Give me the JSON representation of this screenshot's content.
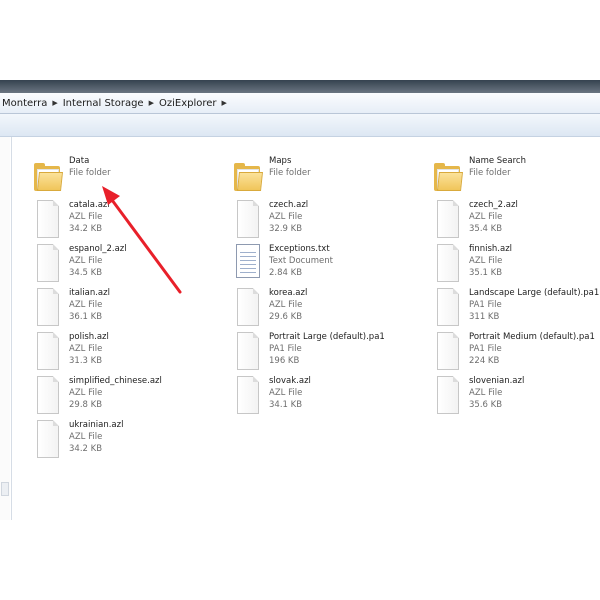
{
  "address_bar": {
    "crumbs": [
      "Monterra",
      "Internal Storage",
      "OziExplorer"
    ]
  },
  "items": [
    {
      "name": "Data",
      "type": "File folder",
      "size": "",
      "icon": "folder-icon"
    },
    {
      "name": "Maps",
      "type": "File folder",
      "size": "",
      "icon": "folder-icon"
    },
    {
      "name": "Name Search",
      "type": "File folder",
      "size": "",
      "icon": "folder-icon"
    },
    {
      "name": "catala.azl",
      "type": "AZL File",
      "size": "34.2 KB",
      "icon": "file-icon"
    },
    {
      "name": "czech.azl",
      "type": "AZL File",
      "size": "32.9 KB",
      "icon": "file-icon"
    },
    {
      "name": "czech_2.azl",
      "type": "AZL File",
      "size": "35.4 KB",
      "icon": "file-icon"
    },
    {
      "name": "espanol_2.azl",
      "type": "AZL File",
      "size": "34.5 KB",
      "icon": "file-icon"
    },
    {
      "name": "Exceptions.txt",
      "type": "Text Document",
      "size": "2.84 KB",
      "icon": "text-document-icon"
    },
    {
      "name": "finnish.azl",
      "type": "AZL File",
      "size": "35.1 KB",
      "icon": "file-icon"
    },
    {
      "name": "italian.azl",
      "type": "AZL File",
      "size": "36.1 KB",
      "icon": "file-icon"
    },
    {
      "name": "korea.azl",
      "type": "AZL File",
      "size": "29.6 KB",
      "icon": "file-icon"
    },
    {
      "name": "Landscape Large (default).pa1",
      "type": "PA1 File",
      "size": "311 KB",
      "icon": "file-icon"
    },
    {
      "name": "polish.azl",
      "type": "AZL File",
      "size": "31.3 KB",
      "icon": "file-icon"
    },
    {
      "name": "Portrait Large (default).pa1",
      "type": "PA1 File",
      "size": "196 KB",
      "icon": "file-icon"
    },
    {
      "name": "Portrait Medium (default).pa1",
      "type": "PA1 File",
      "size": "224 KB",
      "icon": "file-icon"
    },
    {
      "name": "simplified_chinese.azl",
      "type": "AZL File",
      "size": "29.8 KB",
      "icon": "file-icon"
    },
    {
      "name": "slovak.azl",
      "type": "AZL File",
      "size": "34.1 KB",
      "icon": "file-icon"
    },
    {
      "name": "slovenian.azl",
      "type": "AZL File",
      "size": "35.6 KB",
      "icon": "file-icon"
    },
    {
      "name": "ukrainian.azl",
      "type": "AZL File",
      "size": "34.2 KB",
      "icon": "file-icon"
    }
  ],
  "colors": {
    "annotation_arrow": "#e8202a",
    "folder": "#e5b74a"
  }
}
